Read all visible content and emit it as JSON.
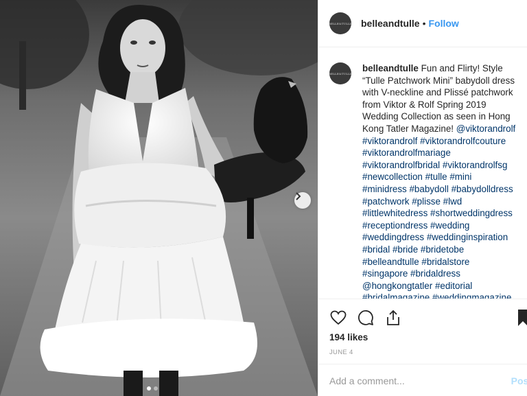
{
  "post": {
    "username": "belleandtulle",
    "separator": "•",
    "follow_label": "Follow",
    "avatar_text": "BELLE&TULLE",
    "caption_text": "Fun and Flirty! Style “Tulle Patchwork Mini” babydoll dress with V-neckline and Plissé patchwork from Viktor & Rolf Spring 2019 Wedding Collection as seen in Hong Kong Tatler Magazine!",
    "caption_tags": [
      "@viktorandrolf",
      "#viktorandrolf",
      "#viktorandrolfcouture",
      "#viktorandrolfmariage",
      "#viktorandrolfbridal",
      "#viktorandrolfsg",
      "#newcollection",
      "#tulle",
      "#mini",
      "#minidress",
      "#babydoll",
      "#babydolldress",
      "#patchwork",
      "#plisse",
      "#lwd",
      "#littlewhitedress",
      "#shortweddingdress",
      "#receptiondress",
      "#wedding",
      "#weddingdress",
      "#weddinginspiration",
      "#bridal",
      "#bride",
      "#bridetobe",
      "#belleandtulle",
      "#bridalstore",
      "#singapore",
      "#bridaldress",
      "@hongkongtatler",
      "#editorial",
      "#bridalmagazine",
      "#weddingmagazine"
    ],
    "likes": "194 likes",
    "date": "JUNE 4",
    "comment_placeholder": "Add a comment...",
    "post_label": "Post",
    "icons": {
      "like": "heart-icon",
      "comment": "comment-icon",
      "share": "share-icon",
      "save": "bookmark-icon",
      "next": "chevron-right-icon"
    },
    "colors": {
      "follow": "#3897f0",
      "hashtag": "#003569",
      "post_disabled": "#b2dffc"
    },
    "carousel": {
      "total": 2,
      "active": 1
    }
  }
}
